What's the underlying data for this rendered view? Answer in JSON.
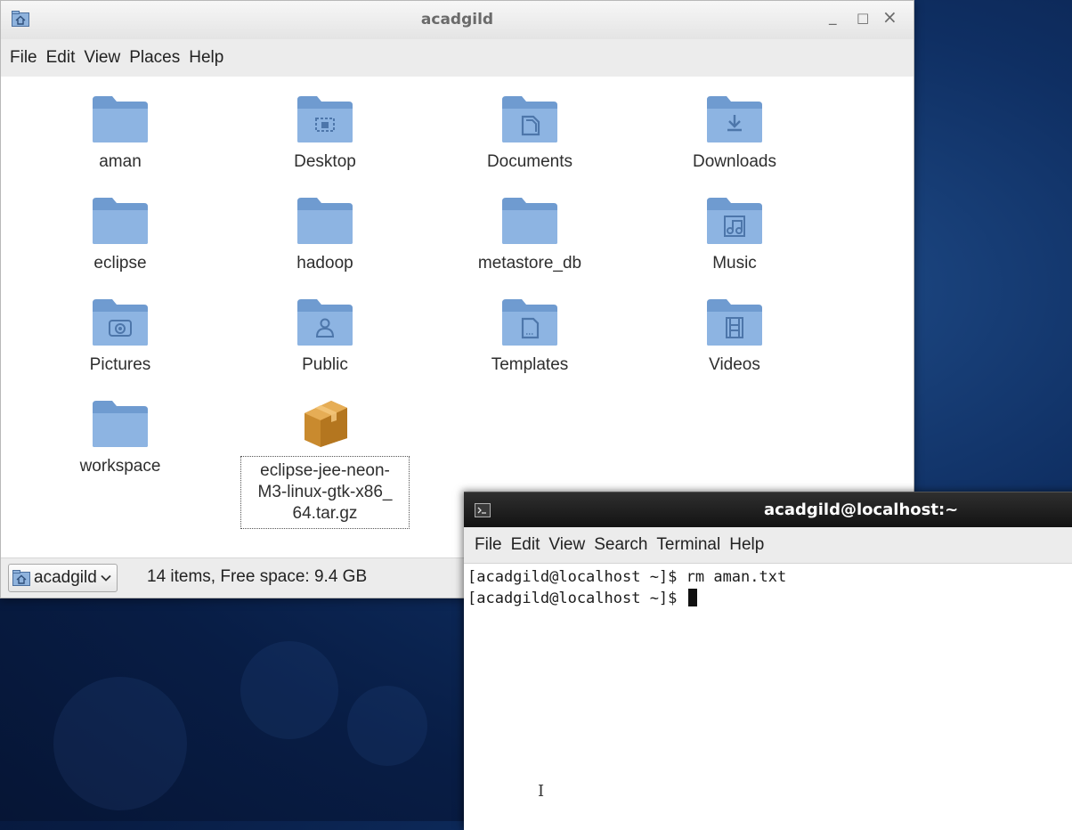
{
  "file_manager": {
    "title": "acadgild",
    "window_controls": {
      "minimize": "_",
      "maximize": "□",
      "close": "×"
    },
    "menu": [
      "File",
      "Edit",
      "View",
      "Places",
      "Help"
    ],
    "items": [
      {
        "label": "aman",
        "icon": "folder-icon"
      },
      {
        "label": "Desktop",
        "icon": "folder-desktop-icon"
      },
      {
        "label": "Documents",
        "icon": "folder-documents-icon"
      },
      {
        "label": "Downloads",
        "icon": "folder-downloads-icon"
      },
      {
        "label": "eclipse",
        "icon": "folder-icon"
      },
      {
        "label": "hadoop",
        "icon": "folder-icon"
      },
      {
        "label": "metastore_db",
        "icon": "folder-icon"
      },
      {
        "label": "Music",
        "icon": "folder-music-icon"
      },
      {
        "label": "Pictures",
        "icon": "folder-pictures-icon"
      },
      {
        "label": "Public",
        "icon": "folder-public-icon"
      },
      {
        "label": "Templates",
        "icon": "folder-templates-icon"
      },
      {
        "label": "Videos",
        "icon": "folder-videos-icon"
      },
      {
        "label": "workspace",
        "icon": "folder-icon"
      },
      {
        "label": "eclipse-jee-neon-M3-linux-gtk-x86_64.tar.gz",
        "label_lines": [
          "eclipse-jee-neon-",
          "M3-linux-gtk-x86_",
          "64.tar.gz"
        ],
        "icon": "archive-package-icon",
        "selected": true
      }
    ],
    "status": {
      "location": "acadgild",
      "text": "14 items, Free space: 9.4 GB"
    }
  },
  "terminal": {
    "title": "acadgild@localhost:~",
    "menu": [
      "File",
      "Edit",
      "View",
      "Search",
      "Terminal",
      "Help"
    ],
    "lines": [
      "[acadgild@localhost ~]$ rm aman.txt",
      "[acadgild@localhost ~]$ "
    ]
  },
  "colors": {
    "folder_blue": "#7aa4d6",
    "desktop_background": "#0f2f63"
  }
}
